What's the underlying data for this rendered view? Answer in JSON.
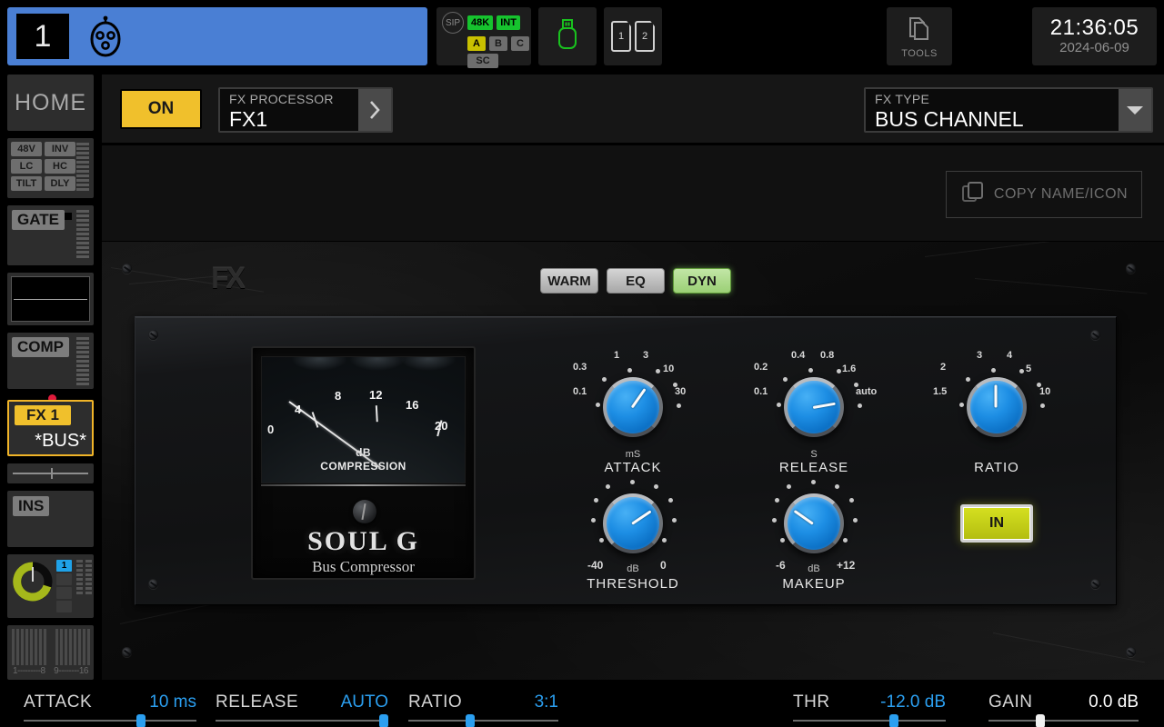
{
  "topbar": {
    "channel": {
      "number": "1",
      "icon": "mic-icon",
      "color": "#4a7fd4"
    },
    "status": {
      "sip": "SIP",
      "rate": "48K",
      "clock": "INT",
      "layers": [
        "A",
        "B",
        "C"
      ],
      "active_layer": "A",
      "sc": "SC"
    },
    "usb_icon": "usb-icon",
    "sd_cards": [
      "1",
      "2"
    ],
    "tools": {
      "label": "TOOLS",
      "icon": "pages-icon"
    },
    "clock": {
      "time": "21:36:05",
      "date": "2024-06-09"
    }
  },
  "sidebar": {
    "home": "HOME",
    "preamp": [
      "48V",
      "INV",
      "LC",
      "HC",
      "TILT",
      "DLY"
    ],
    "gate": "GATE",
    "comp": "COMP",
    "fx": {
      "tag": "FX 1",
      "bus": "*BUS*"
    },
    "ins": "INS",
    "mix_select": "1",
    "meter_scale_left": "1---------8",
    "meter_scale_right": "9--------16"
  },
  "header": {
    "on_label": "ON",
    "fx_processor": {
      "caption": "FX PROCESSOR",
      "value": "FX1",
      "arrow": "chevron-right-icon"
    },
    "fx_type": {
      "caption": "FX TYPE",
      "value": "BUS CHANNEL",
      "arrow": "chevron-down-icon"
    },
    "copy_name_icon": {
      "label": "COPY NAME/ICON",
      "icon": "copy-icon"
    }
  },
  "plugin": {
    "fx_logo": "FX",
    "tabs": [
      {
        "label": "WARM",
        "active": false
      },
      {
        "label": "EQ",
        "active": false
      },
      {
        "label": "DYN",
        "active": true
      }
    ],
    "vu": {
      "ticks": [
        "0",
        "4",
        "8",
        "12",
        "16",
        "20"
      ],
      "caption_line1": "dB",
      "caption_line2": "COMPRESSION",
      "needle_value": 0
    },
    "brand": {
      "name": "SOUL G",
      "subtitle": "Bus Compressor"
    },
    "knobs": [
      {
        "name": "ATTACK",
        "unit": "mS",
        "labels": [
          "0.1",
          "0.3",
          "1",
          "3",
          "10",
          "30"
        ],
        "value_index": 4,
        "pointer_deg": -55
      },
      {
        "name": "RELEASE",
        "unit": "S",
        "labels": [
          "0.1",
          "0.2",
          "0.4",
          "0.8",
          "1.6",
          "auto"
        ],
        "value_index": 5,
        "pointer_deg": -10
      },
      {
        "name": "RATIO",
        "unit": "",
        "labels": [
          "1.5",
          "2",
          "3",
          "4",
          "5",
          "10"
        ],
        "value_index": 2,
        "pointer_deg": -90
      },
      {
        "name": "THRESHOLD",
        "unit": "dB",
        "min_label": "-40",
        "max_label": "0",
        "pointer_deg": -34
      },
      {
        "name": "MAKEUP",
        "unit": "dB",
        "min_label": "-6",
        "max_label": "+12",
        "pointer_deg": -145
      }
    ],
    "in_button": "IN"
  },
  "bottom_params": [
    {
      "name": "ATTACK",
      "value": "10 ms",
      "accent": true,
      "pos": 0.68
    },
    {
      "name": "RELEASE",
      "value": "AUTO",
      "accent": true,
      "pos": 1.0
    },
    {
      "name": "RATIO",
      "value": "3:1",
      "accent": true,
      "pos": 0.41
    },
    {
      "name": "THR",
      "value": "-12.0 dB",
      "accent": true,
      "pos": 0.66
    },
    {
      "name": "GAIN",
      "value": "0.0 dB",
      "accent": false,
      "pos": 0.33
    }
  ],
  "colors": {
    "accent_blue": "#2b9ff0",
    "knob_blue": "#1d8ee4",
    "amber": "#f0c02c",
    "green": "#16c32e",
    "yellow_green": "#c5d020",
    "channel_blue": "#4a7fd4",
    "red_dot": "#e01b3c"
  }
}
